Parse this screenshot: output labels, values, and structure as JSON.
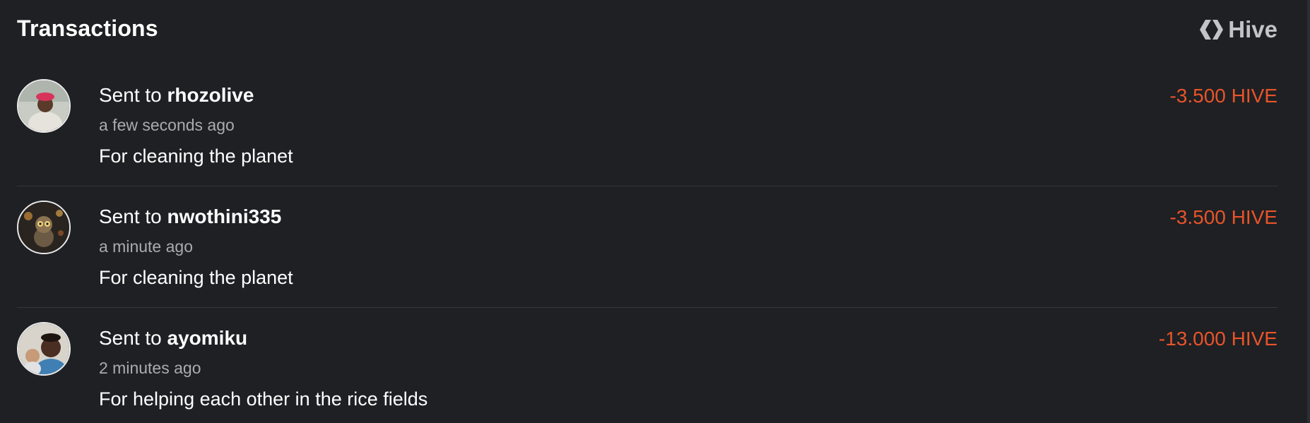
{
  "header": {
    "title": "Transactions",
    "brand_label": "Hive",
    "brand_icon": "hive-logo-icon"
  },
  "colors": {
    "background": "#1e2023",
    "amount_negative": "#e8542a",
    "muted_text": "#a9abaf",
    "divider": "#34373b"
  },
  "transactions": [
    {
      "prefix": "Sent to ",
      "recipient": "rhozolive",
      "time": "a few seconds ago",
      "memo": "For cleaning the planet",
      "amount": "-3.500 HIVE"
    },
    {
      "prefix": "Sent to ",
      "recipient": "nwothini335",
      "time": "a minute ago",
      "memo": "For cleaning the planet",
      "amount": "-3.500 HIVE"
    },
    {
      "prefix": "Sent to ",
      "recipient": "ayomiku",
      "time": "2 minutes ago",
      "memo": "For helping each other in the rice fields",
      "amount": "-13.000 HIVE"
    }
  ]
}
